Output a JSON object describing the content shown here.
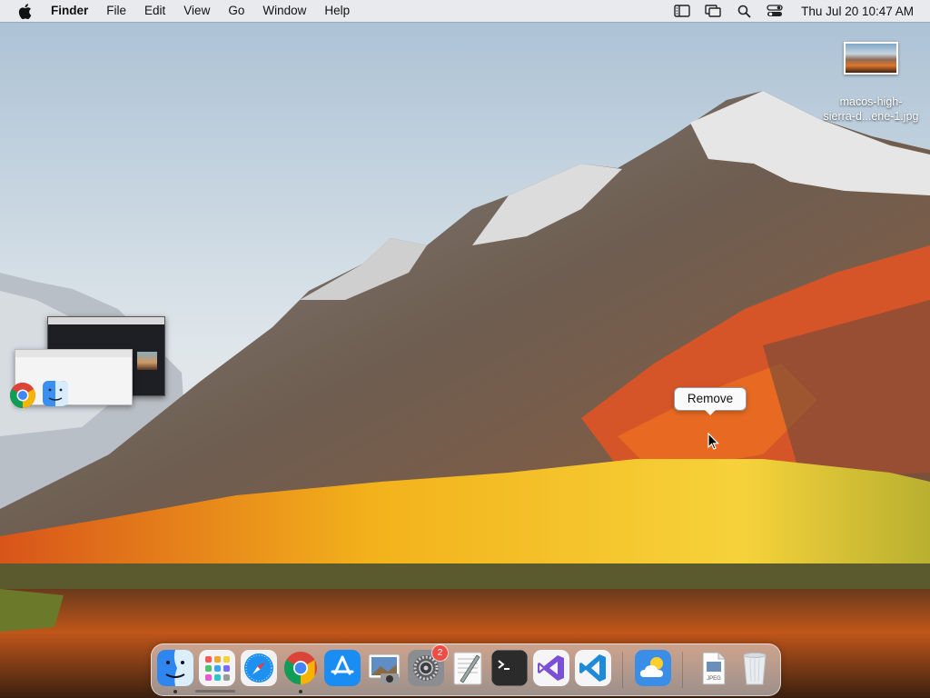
{
  "menubar": {
    "apple_icon": "apple-logo-icon",
    "app_name": "Finder",
    "menus": [
      "File",
      "Edit",
      "View",
      "Go",
      "Window",
      "Help"
    ],
    "status_icons": [
      "sidebar-list-icon",
      "display-mirror-icon",
      "spotlight-search-icon",
      "control-center-icon"
    ],
    "datetime": "Thu Jul 20  10:47 AM"
  },
  "desktop": {
    "file": {
      "name": "macos-high-sierra-d...ene-1.jpg",
      "name_line1": "macos-high-",
      "name_line2": "sierra-d...ene-1.jpg"
    }
  },
  "tooltip": {
    "text": "Remove"
  },
  "stage_manager": {
    "apps": [
      "Chrome",
      "Finder"
    ]
  },
  "dock": {
    "apps": [
      {
        "name": "Finder",
        "icon": "finder-icon",
        "running": true
      },
      {
        "name": "Launchpad",
        "icon": "launchpad-icon",
        "running": false
      },
      {
        "name": "Safari",
        "icon": "safari-icon",
        "running": false
      },
      {
        "name": "Google Chrome",
        "icon": "chrome-icon",
        "running": true
      },
      {
        "name": "App Store",
        "icon": "app-store-icon",
        "running": false
      },
      {
        "name": "Preview",
        "icon": "preview-icon",
        "running": false
      },
      {
        "name": "System Settings",
        "icon": "system-settings-icon",
        "running": false,
        "badge": "2"
      },
      {
        "name": "TextEdit",
        "icon": "textedit-icon",
        "running": false
      },
      {
        "name": "Terminal",
        "icon": "terminal-icon",
        "running": false
      },
      {
        "name": "Visual Studio",
        "icon": "visual-studio-icon",
        "running": false
      },
      {
        "name": "Visual Studio Code",
        "icon": "vscode-icon",
        "running": false
      },
      {
        "name": "Weather",
        "icon": "weather-icon",
        "running": false
      },
      {
        "name": "JPEG file",
        "icon": "jpeg-document-icon",
        "running": false,
        "label": "JPEG"
      },
      {
        "name": "Trash",
        "icon": "trash-icon",
        "running": false
      }
    ]
  }
}
